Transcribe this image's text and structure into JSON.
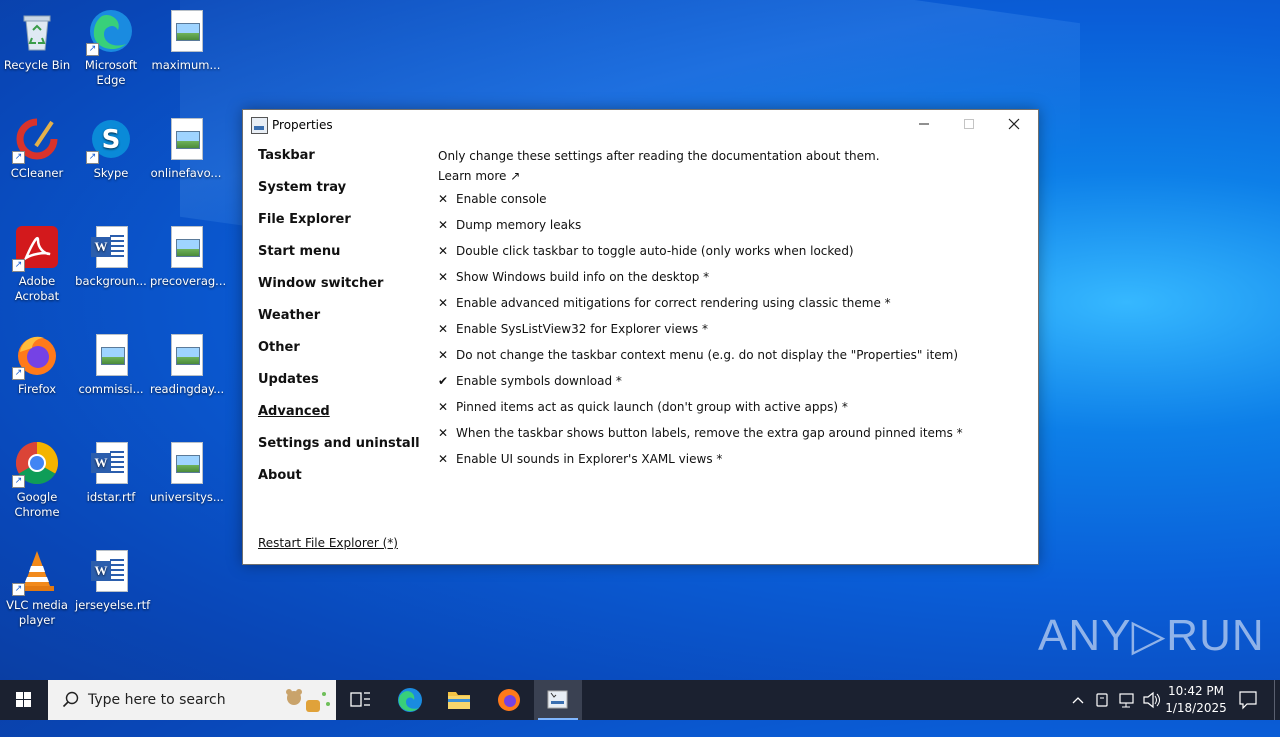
{
  "desktop": {
    "icons": [
      {
        "label": "Recycle Bin"
      },
      {
        "label": "Microsoft Edge"
      },
      {
        "label": "maximum..."
      },
      {
        "label": "CCleaner"
      },
      {
        "label": "Skype"
      },
      {
        "label": "onlinefavo..."
      },
      {
        "label": "Adobe Acrobat"
      },
      {
        "label": "backgroun..."
      },
      {
        "label": "precoverag..."
      },
      {
        "label": "Firefox"
      },
      {
        "label": "commissi..."
      },
      {
        "label": "readingday..."
      },
      {
        "label": "Google Chrome"
      },
      {
        "label": "idstar.rtf"
      },
      {
        "label": "universitys..."
      },
      {
        "label": "VLC media player"
      },
      {
        "label": "jerseyelse.rtf"
      }
    ]
  },
  "window": {
    "title": "Properties",
    "nav": [
      {
        "label": "Taskbar"
      },
      {
        "label": "System tray"
      },
      {
        "label": "File Explorer"
      },
      {
        "label": "Start menu"
      },
      {
        "label": "Window switcher"
      },
      {
        "label": "Weather"
      },
      {
        "label": "Other"
      },
      {
        "label": "Updates"
      },
      {
        "label": "Advanced",
        "active": true
      },
      {
        "label": "Settings and uninstall"
      },
      {
        "label": "About"
      }
    ],
    "intro": "Only change these settings after reading the documentation about them.",
    "learn_more": "Learn more ↗",
    "options": [
      {
        "mark": "✕",
        "label": "Enable console"
      },
      {
        "mark": "✕",
        "label": "Dump memory leaks"
      },
      {
        "mark": "✕",
        "label": "Double click taskbar to toggle auto-hide (only works when locked)"
      },
      {
        "mark": "✕",
        "label": "Show Windows build info on the desktop *"
      },
      {
        "mark": "✕",
        "label": "Enable advanced mitigations for correct rendering using classic theme *"
      },
      {
        "mark": "✕",
        "label": "Enable SysListView32 for Explorer views *"
      },
      {
        "mark": "✕",
        "label": "Do not change the taskbar context menu (e.g. do not display the \"Properties\" item)"
      },
      {
        "mark": "✔",
        "label": "Enable symbols download *"
      },
      {
        "mark": "✕",
        "label": "Pinned items act as quick launch (don't group with active apps) *"
      },
      {
        "mark": "✕",
        "label": "When the taskbar shows button labels, remove the extra gap around pinned items *"
      },
      {
        "mark": "✕",
        "label": "Enable UI sounds in Explorer's XAML views *"
      }
    ],
    "restart": "Restart File Explorer (*)"
  },
  "watermark": "ANY▷RUN",
  "taskbar": {
    "search_placeholder": "Type here to search",
    "time": "10:42 PM",
    "date": "1/18/2025"
  }
}
